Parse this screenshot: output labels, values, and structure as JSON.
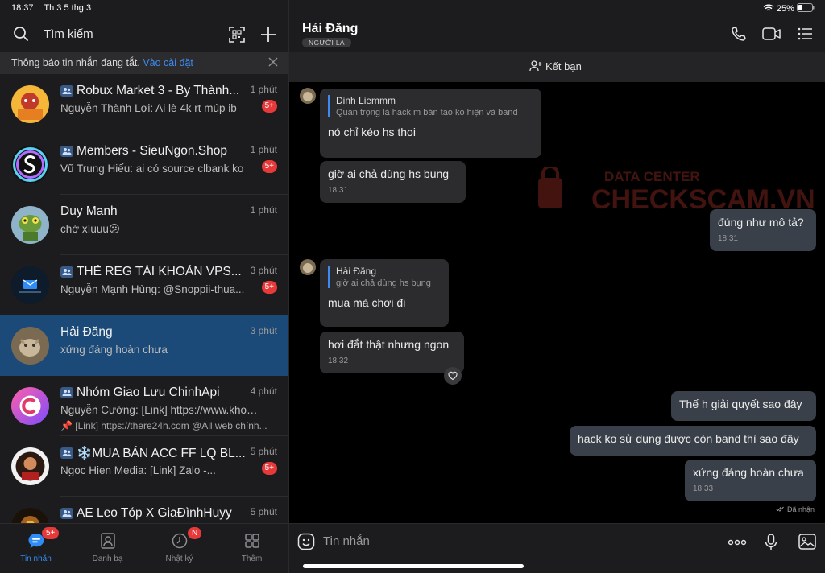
{
  "status": {
    "time": "18:37",
    "date": "Th 3 5 thg 3",
    "battery": "25%"
  },
  "search": {
    "label": "Tìm kiếm"
  },
  "notice": {
    "text": "Thông báo tin nhắn đang tắt.",
    "link": "Vào cài đặt"
  },
  "conversations": [
    {
      "title": "Robux Market 3 - By Thành...",
      "time": "1 phút",
      "msg": "Nguyễn Thành Lợi: Ai lè 4k rt múp ib",
      "badge": "5+"
    },
    {
      "title": "Members - SieuNgon.Shop",
      "time": "1 phút",
      "msg": "Vũ Trung Hiếu: ai có source clbank ko",
      "badge": "5+"
    },
    {
      "title": "Duy Manh",
      "time": "1 phút",
      "msg": "chờ xíuuu😕"
    },
    {
      "title": "THẺ REG TÀI KHOẢN VPS...",
      "time": "3 phút",
      "msg": "Nguyễn Mạnh Hùng: @Snoppii-thua...",
      "badge": "5+"
    },
    {
      "title": "Hải Đăng",
      "time": "3 phút",
      "msg": "xứng đáng hoàn chưa"
    },
    {
      "title": "Nhóm Giao Lưu ChinhApi",
      "time": "4 phút",
      "msg": "Nguyễn Cường: [Link] https://www.khoco...",
      "msg2": "📌 [Link] https://there24h.com @All web chính..."
    },
    {
      "title": "❄️MUA BÁN ACC FF LQ BL...",
      "time": "5 phút",
      "msg": "Ngoc Hien Media: [Link] Zalo -...",
      "badge": "5+"
    },
    {
      "title": "AE Leo Tóp X GiaĐìnhHuyy",
      "time": "5 phút",
      "msg": ""
    }
  ],
  "nav": [
    {
      "label": "Tin nhắn",
      "badge": "5+"
    },
    {
      "label": "Danh bạ"
    },
    {
      "label": "Nhật ký",
      "badge": "N"
    },
    {
      "label": "Thêm"
    }
  ],
  "chat": {
    "name": "Hải Đăng",
    "tag": "NGƯỜI LẠ",
    "add_friend": "Kết bạn",
    "messages": [
      {
        "quote_name": "Dinh Liemmm",
        "quote_text": "Quan trọng là hack m bán tao ko hiện và band",
        "text": "nó chỉ kéo hs thoi"
      },
      {
        "text": "giờ ai chả dùng hs bụng",
        "time": "18:31"
      },
      {
        "text": "đúng như mô tả?",
        "time": "18:31"
      },
      {
        "quote_name": "Hải Đăng",
        "quote_text": "giờ ai chả dùng hs bụng",
        "text": "mua mà chơi đi"
      },
      {
        "text": "hơi đắt thật nhưng ngon",
        "time": "18:32"
      },
      {
        "text": "Thế h giải quyết sao đây"
      },
      {
        "text": "hack ko sử dụng được còn band thì sao đây"
      },
      {
        "text": "xứng đáng hoàn chưa",
        "time": "18:33"
      }
    ],
    "seen": "Đã nhận",
    "placeholder": "Tin nhắn"
  },
  "watermark": {
    "line1": "DATA CENTER",
    "line2": "CHECKSCAM.VN"
  },
  "colors": {
    "accent": "#2f8cf5",
    "active_row": "#1b4a78",
    "badge": "#e5393a"
  }
}
